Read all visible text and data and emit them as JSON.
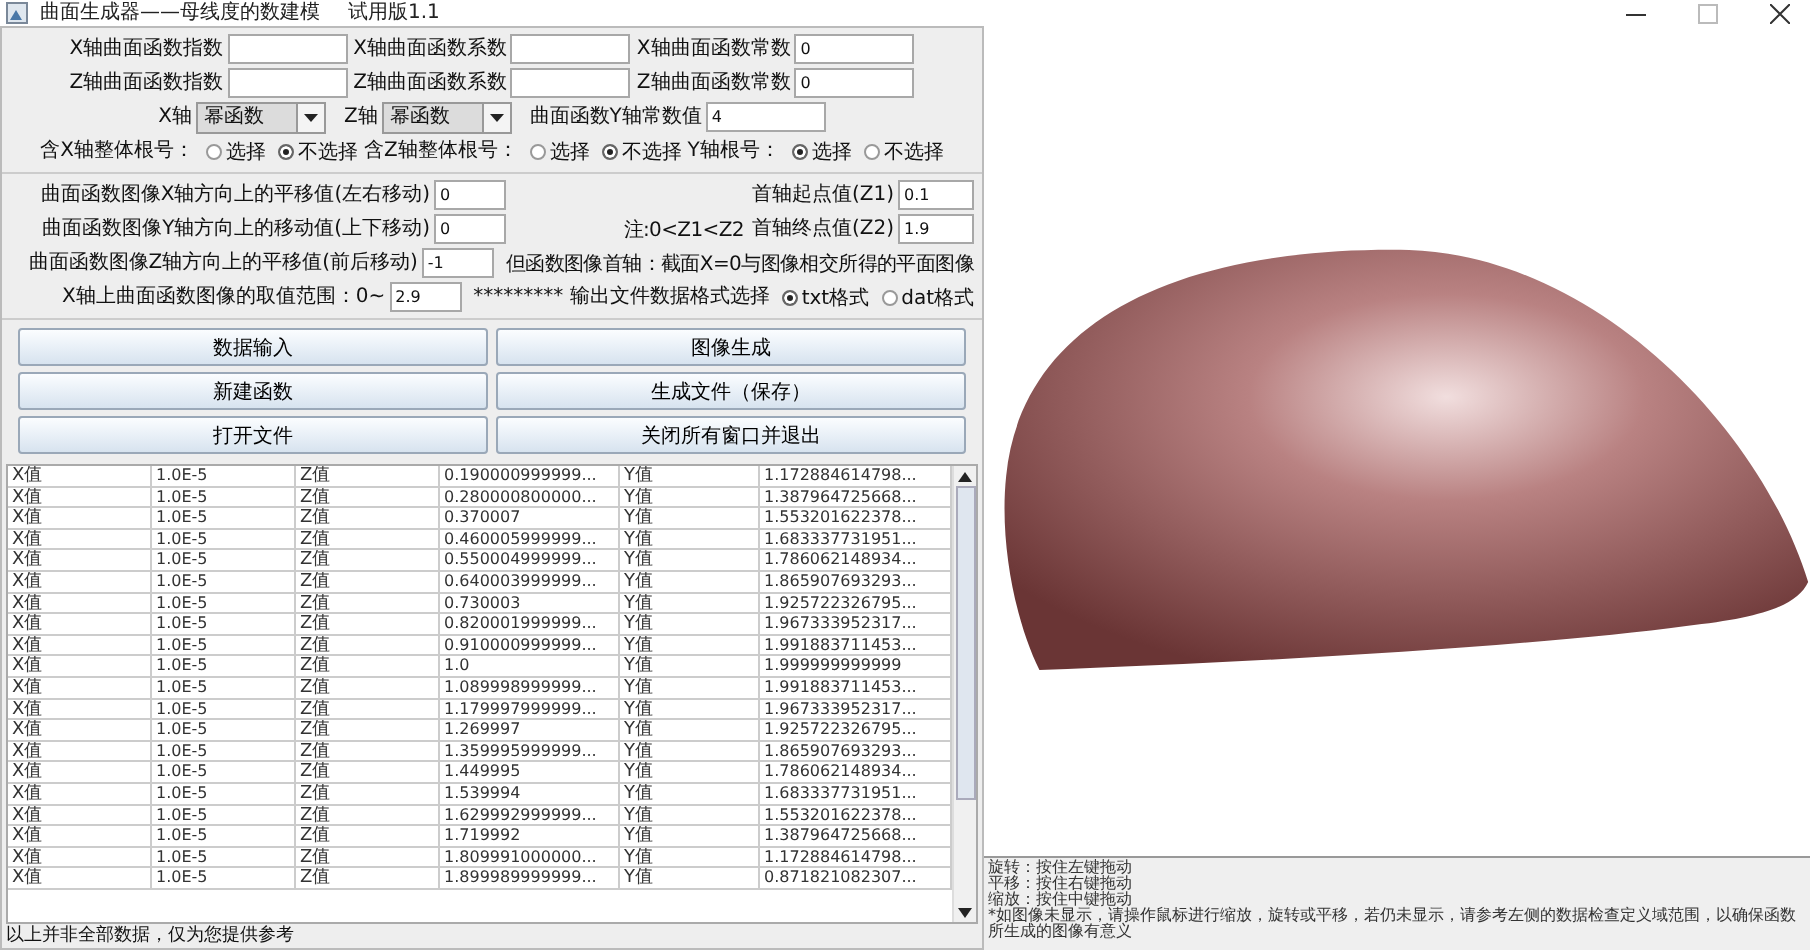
{
  "window": {
    "title": "曲面生成器——母线度的数建模",
    "version": "试用版1.1"
  },
  "params": {
    "rows": [
      {
        "items": [
          {
            "kind": "field",
            "label": "X轴曲面函数指数"
          },
          {
            "kind": "field",
            "label": "X轴曲面函数系数"
          },
          {
            "kind": "field",
            "label": "X轴曲面函数常数",
            "value": "0"
          }
        ]
      },
      {
        "items": [
          {
            "kind": "field",
            "label": "Z轴曲面函数指数"
          },
          {
            "kind": "field",
            "label": "Z轴曲面函数系数"
          },
          {
            "kind": "field",
            "label": "Z轴曲面函数常数",
            "value": "0"
          }
        ]
      },
      {
        "items": [
          {
            "kind": "combo",
            "label": "X轴",
            "value": "幂函数"
          },
          {
            "kind": "combo",
            "label": "Z轴",
            "value": "幂函数"
          },
          {
            "kind": "field",
            "label": "曲面函数Y轴常数值",
            "value": "4"
          }
        ]
      },
      {
        "items": [
          {
            "kind": "radio",
            "label": "含X轴整体根号：",
            "options": [
              {
                "label": "选择",
                "selected": false
              },
              {
                "label": "不选择",
                "selected": true
              }
            ]
          },
          {
            "kind": "radio",
            "label": "含Z轴整体根号：",
            "options": [
              {
                "label": "选择",
                "selected": false
              },
              {
                "label": "不选择",
                "selected": true
              }
            ]
          },
          {
            "kind": "radio",
            "label": "Y轴根号：",
            "options": [
              {
                "label": "选择",
                "selected": true
              },
              {
                "label": "不选择",
                "selected": false
              }
            ]
          }
        ]
      }
    ]
  },
  "transform": {
    "rows": [
      {
        "left": {
          "label": "曲面函数图像X轴方向上的平移值(左右移动)",
          "value": "0"
        },
        "right": [
          {
            "kind": "field",
            "label": "首轴起点值(Z1)",
            "value": "0.1"
          }
        ]
      },
      {
        "left": {
          "label": "曲面函数图像Y轴方向上的移动值(上下移动)",
          "value": "0"
        },
        "right": [
          {
            "kind": "note",
            "text": "注:0<Z1<Z2"
          },
          {
            "kind": "field",
            "label": "首轴终点值(Z2)",
            "value": "1.9"
          }
        ]
      },
      {
        "left": {
          "label": "曲面函数图像Z轴方向上的平移值(前后移动)",
          "value": "-1"
        },
        "right": [
          {
            "kind": "note",
            "text": "但函数图像首轴：截面X=0与图像相交所得的平面图像"
          }
        ]
      },
      {
        "left": {
          "label": "X轴上曲面函数图像的取值范围：0~",
          "value": "2.9"
        },
        "right": [
          {
            "kind": "radio",
            "label": "********* 输出文件数据格式选择",
            "options": [
              {
                "label": "txt格式",
                "selected": true
              },
              {
                "label": "dat格式",
                "selected": false
              }
            ]
          }
        ]
      }
    ]
  },
  "buttons": [
    "数据输入",
    "图像生成",
    "新建函数",
    "生成文件（保存）",
    "打开文件",
    "关闭所有窗口并退出"
  ],
  "table": {
    "rows": [
      [
        "X值",
        "1.0E-5",
        "Z值",
        "0.190000999999...",
        "Y值",
        "1.172884614798..."
      ],
      [
        "X值",
        "1.0E-5",
        "Z值",
        "0.280000800000...",
        "Y值",
        "1.387964725668..."
      ],
      [
        "X值",
        "1.0E-5",
        "Z值",
        "0.370007",
        "Y值",
        "1.553201622378..."
      ],
      [
        "X值",
        "1.0E-5",
        "Z值",
        "0.460005999999...",
        "Y值",
        "1.683337731951..."
      ],
      [
        "X值",
        "1.0E-5",
        "Z值",
        "0.550004999999...",
        "Y值",
        "1.786062148934..."
      ],
      [
        "X值",
        "1.0E-5",
        "Z值",
        "0.640003999999...",
        "Y值",
        "1.865907693293..."
      ],
      [
        "X值",
        "1.0E-5",
        "Z值",
        "0.730003",
        "Y值",
        "1.925722326795..."
      ],
      [
        "X值",
        "1.0E-5",
        "Z值",
        "0.820001999999...",
        "Y值",
        "1.967333952317..."
      ],
      [
        "X值",
        "1.0E-5",
        "Z值",
        "0.910000999999...",
        "Y值",
        "1.991883711453..."
      ],
      [
        "X值",
        "1.0E-5",
        "Z值",
        "1.0",
        "Y值",
        "1.999999999999"
      ],
      [
        "X值",
        "1.0E-5",
        "Z值",
        "1.089998999999...",
        "Y值",
        "1.991883711453..."
      ],
      [
        "X值",
        "1.0E-5",
        "Z值",
        "1.179997999999...",
        "Y值",
        "1.967333952317..."
      ],
      [
        "X值",
        "1.0E-5",
        "Z值",
        "1.269997",
        "Y值",
        "1.925722326795..."
      ],
      [
        "X值",
        "1.0E-5",
        "Z值",
        "1.359995999999...",
        "Y值",
        "1.865907693293..."
      ],
      [
        "X值",
        "1.0E-5",
        "Z值",
        "1.449995",
        "Y值",
        "1.786062148934..."
      ],
      [
        "X值",
        "1.0E-5",
        "Z值",
        "1.539994",
        "Y值",
        "1.683337731951..."
      ],
      [
        "X值",
        "1.0E-5",
        "Z值",
        "1.629992999999...",
        "Y值",
        "1.553201622378..."
      ],
      [
        "X值",
        "1.0E-5",
        "Z值",
        "1.719992",
        "Y值",
        "1.387964725668..."
      ],
      [
        "X值",
        "1.0E-5",
        "Z值",
        "1.809991000000...",
        "Y值",
        "1.172884614798..."
      ],
      [
        "X值",
        "1.0E-5",
        "Z值",
        "1.899989999999...",
        "Y值",
        "0.871821082307..."
      ]
    ]
  },
  "status_bar": "以上并非全部数据，仅为您提供参考",
  "console": {
    "lines": [
      "旋转：按住左键拖动",
      "平移：按住右键拖动",
      "缩放：按住中键拖动"
    ],
    "note": "*如图像未显示，请操作鼠标进行缩放，旋转或平移，若仍未显示，请参考左侧的数据检查定义域范围，以确保函数所生成的图像有意义"
  }
}
